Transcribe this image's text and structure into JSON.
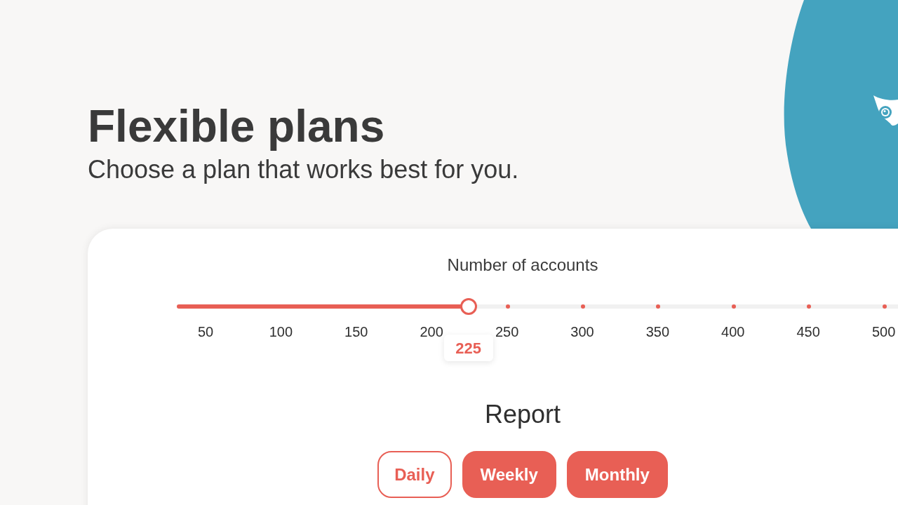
{
  "heading": {
    "title": "Flexible plans",
    "subtitle": "Choose a plan that works best for you."
  },
  "accounts": {
    "label": "Number of accounts",
    "level": 0.392,
    "value": "225",
    "ticks": [
      "50",
      "100",
      "150",
      "200",
      "250",
      "300",
      "350",
      "400",
      "450",
      "500"
    ]
  },
  "report": {
    "title": "Report",
    "options": [
      {
        "label": "Daily",
        "selected": false
      },
      {
        "label": "Weekly",
        "selected": true
      },
      {
        "label": "Monthly",
        "selected": true
      }
    ]
  }
}
